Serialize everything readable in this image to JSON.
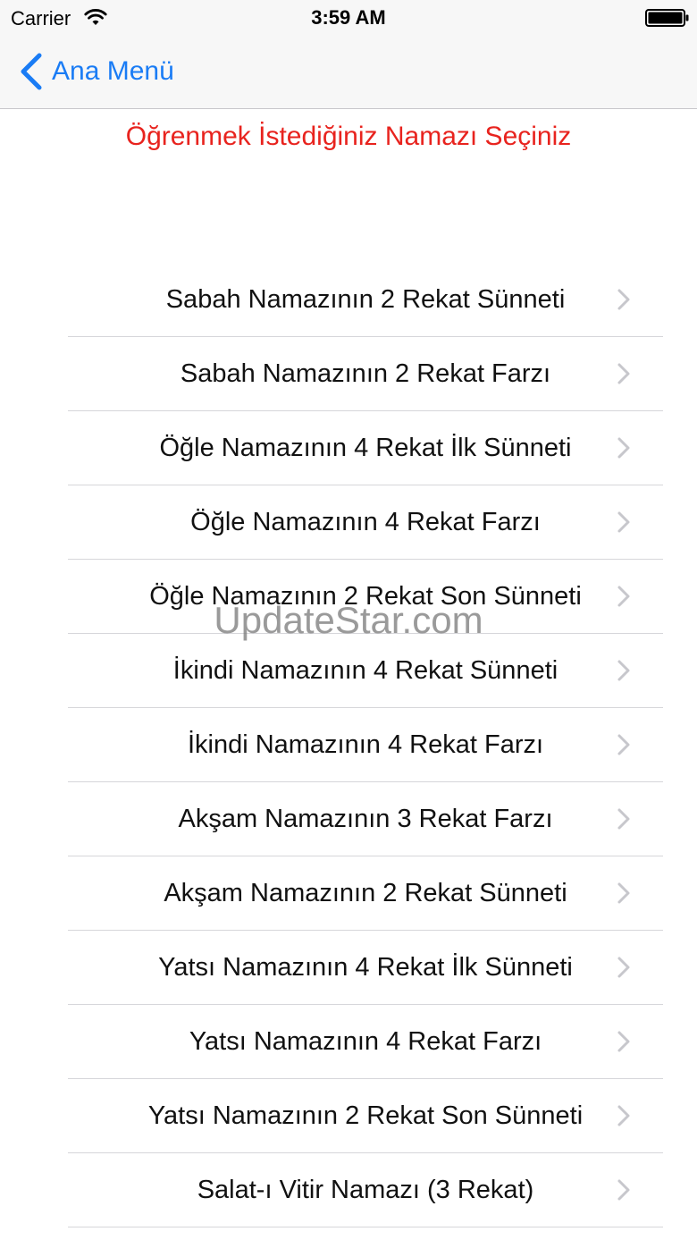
{
  "status_bar": {
    "carrier": "Carrier",
    "time": "3:59 AM",
    "wifi_icon": "wifi-icon",
    "battery_icon": "battery-icon"
  },
  "nav": {
    "back_label": "Ana Menü",
    "back_icon": "chevron-left-icon",
    "accent_color": "#1a7cf5"
  },
  "heading": {
    "text": "Öğrenmek İstediğiniz Namazı Seçiniz",
    "color": "#e8231e"
  },
  "items": [
    {
      "label": "Sabah Namazının 2 Rekat Sünneti"
    },
    {
      "label": "Sabah Namazının 2 Rekat Farzı"
    },
    {
      "label": "Öğle Namazının 4 Rekat İlk Sünneti"
    },
    {
      "label": "Öğle Namazının 4 Rekat Farzı"
    },
    {
      "label": "Öğle Namazının 2 Rekat Son Sünneti"
    },
    {
      "label": "İkindi Namazının 4 Rekat Sünneti"
    },
    {
      "label": "İkindi Namazının 4 Rekat Farzı"
    },
    {
      "label": "Akşam Namazının 3 Rekat Farzı"
    },
    {
      "label": "Akşam Namazının 2 Rekat Sünneti"
    },
    {
      "label": "Yatsı Namazının 4 Rekat İlk Sünneti"
    },
    {
      "label": "Yatsı Namazının 4 Rekat Farzı"
    },
    {
      "label": "Yatsı Namazının 2 Rekat Son Sünneti"
    },
    {
      "label": "Salat-ı Vitir Namazı (3 Rekat)"
    }
  ],
  "watermark": "UpdateStar.com"
}
